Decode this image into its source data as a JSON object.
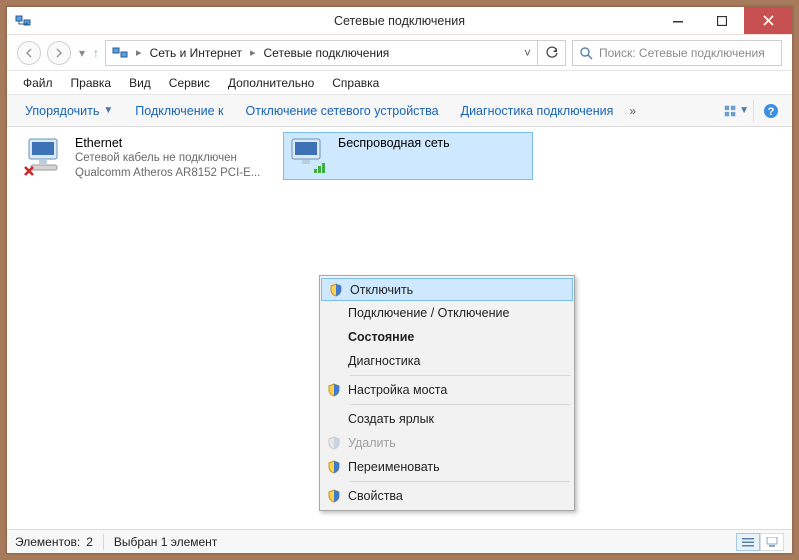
{
  "title": "Сетевые подключения",
  "breadcrumb": {
    "seg1": "Сеть и Интернет",
    "seg2": "Сетевые подключения"
  },
  "search_placeholder": "Поиск: Сетевые подключения",
  "menu": {
    "file": "Файл",
    "edit": "Правка",
    "view": "Вид",
    "service": "Сервис",
    "extra": "Дополнительно",
    "help": "Справка"
  },
  "toolbar": {
    "organize": "Упорядочить",
    "connect_to": "Подключение к",
    "disable_device": "Отключение сетевого устройства",
    "diagnose": "Диагностика подключения"
  },
  "items": {
    "ethernet": {
      "name": "Ethernet",
      "status": "Сетевой кабель не подключен",
      "device": "Qualcomm Atheros AR8152 PCI-E..."
    },
    "wireless": {
      "name": "Беспроводная сеть"
    }
  },
  "context_menu": {
    "disable": "Отключить",
    "connect_disconnect": "Подключение / Отключение",
    "status": "Состояние",
    "diagnose": "Диагностика",
    "bridge": "Настройка моста",
    "create_shortcut": "Создать ярлык",
    "delete": "Удалить",
    "rename": "Переименовать",
    "properties": "Свойства"
  },
  "statusbar": {
    "elements_label": "Элементов:",
    "elements_count": "2",
    "selected_label": "Выбран 1 элемент"
  }
}
